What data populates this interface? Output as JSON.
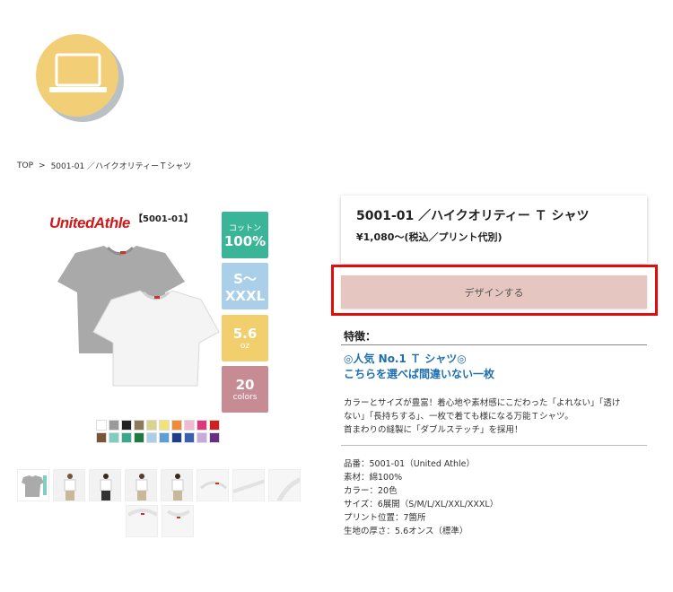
{
  "breadcrumb": {
    "items": [
      "TOP",
      "5001-01 ／ハイクオリティーＴシャツ"
    ],
    "separator": ">"
  },
  "product_image": {
    "brand": "UnitedAthle",
    "code": "【5001-01】",
    "features": [
      {
        "top": "コットン",
        "bottom": "100%"
      },
      {
        "top": "S〜",
        "bottom": "XXXL"
      },
      {
        "top": "5.6",
        "bottom": "oz"
      },
      {
        "top": "20",
        "bottom": "colors"
      }
    ],
    "swatch_colors": [
      "#ffffff",
      "#9a9a9a",
      "#222222",
      "#8d7a5b",
      "#d9d48a",
      "#f2e27a",
      "#ef8a3a",
      "#f3b9cf",
      "#e0367c",
      "#d02020",
      "#7a5436",
      "#7fcfc0",
      "#3aa88a",
      "#1f7a3f",
      "#a9cfe9",
      "#5a9fd6",
      "#203f8a",
      "#3b5fb0",
      "#c9a9d9",
      "#6a2d84"
    ]
  },
  "info": {
    "title": "5001-01 ／ハイクオリティー Ｔ シャツ",
    "price": "¥1,080〜(税込／プリント代別)",
    "design_button": "デザインする"
  },
  "features_section": {
    "heading": "特徴：",
    "highlight_lines": [
      "◎人気 No.1 Ｔ シャツ◎",
      "こちらを選べば間違いない一枚"
    ],
    "description_lines": [
      "カラーとサイズが豊富！着心地や素材感にこだわった「よれない」「透け",
      "ない」「長持ちする」、一枚で着ても様になる万能Ｔシャツ。",
      "首まわりの縫製に「ダブルステッチ」を採用！"
    ]
  },
  "specs": [
    "品番：5001-01（United Athle）",
    "素材：綿100%",
    "カラー：20色",
    "サイズ：6展開（S/M/L/XL/XXL/XXXL）",
    "プリント位置：7箇所",
    "生地の厚さ：5.6オンス（標準）"
  ],
  "colors": {
    "logo_circle": "#f2cf76",
    "design_button_bg": "#e6c6c0",
    "highlight_text": "#1f6fb0",
    "brand_red": "#d01a1a"
  }
}
